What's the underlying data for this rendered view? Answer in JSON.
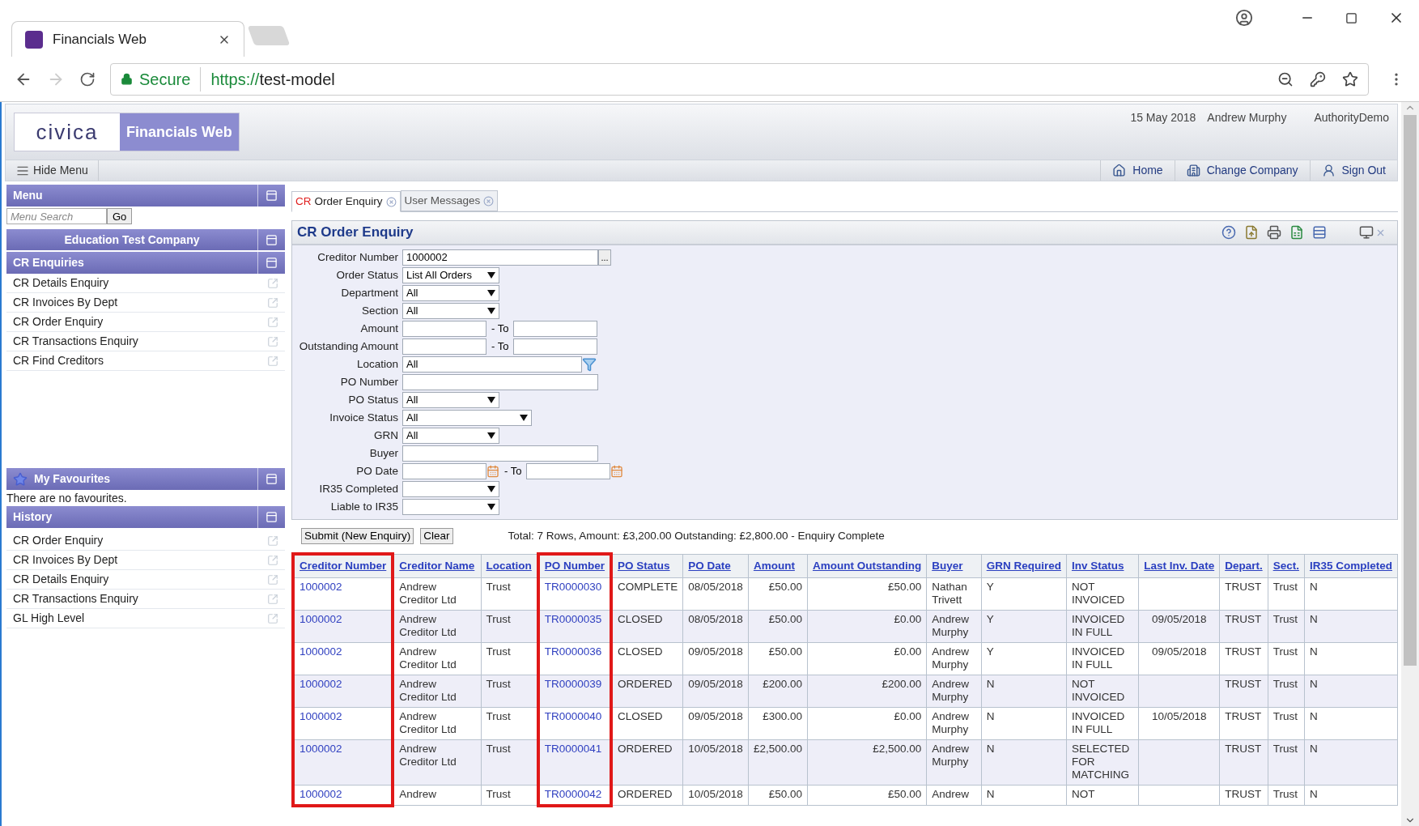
{
  "browser": {
    "tab_title": "Financials Web",
    "secure": "Secure",
    "url_scheme": "https://",
    "url_host": "test-model"
  },
  "header": {
    "logo": "civica",
    "product": "Financials Web",
    "date": "15 May 2018",
    "user": "Andrew Murphy",
    "authority": "AuthorityDemo"
  },
  "toolbar": {
    "hide_menu": "Hide Menu",
    "links": [
      {
        "kind": "home",
        "label": "Home"
      },
      {
        "kind": "company",
        "label": "Change Company"
      },
      {
        "kind": "signout",
        "label": "Sign Out"
      }
    ]
  },
  "sidebar": {
    "menu_title": "Menu",
    "search_placeholder": "Menu Search",
    "go": "Go",
    "company": "Education Test Company",
    "section": "CR Enquiries",
    "items": [
      "CR Details Enquiry",
      "CR Invoices By Dept",
      "CR Order Enquiry",
      "CR Transactions Enquiry",
      "CR Find Creditors"
    ],
    "favourites_title": "My Favourites",
    "favourites_empty": "There are no favourites.",
    "history_title": "History",
    "history": [
      "CR Order Enquiry",
      "CR Invoices By Dept",
      "CR Details Enquiry",
      "CR Transactions Enquiry",
      "GL High Level"
    ]
  },
  "tabs": [
    {
      "code": "CR",
      "label": "Order Enquiry",
      "selected": true
    },
    {
      "label": "User Messages",
      "selected": false
    }
  ],
  "form": {
    "title": "CR Order Enquiry",
    "fields": [
      {
        "kind": "lookup",
        "label": "Creditor Number",
        "value": "1000002",
        "button": "..."
      },
      {
        "kind": "select",
        "label": "Order Status",
        "value": "List All Orders"
      },
      {
        "kind": "select",
        "label": "Department",
        "value": "All"
      },
      {
        "kind": "select",
        "label": "Section",
        "value": "All"
      },
      {
        "kind": "range",
        "label": "Amount",
        "to": "- To"
      },
      {
        "kind": "range",
        "label": "Outstanding Amount",
        "to": "- To"
      },
      {
        "kind": "picker",
        "label": "Location",
        "value": "All"
      },
      {
        "kind": "text",
        "label": "PO Number"
      },
      {
        "kind": "select",
        "label": "PO Status",
        "value": "All"
      },
      {
        "kind": "select",
        "label": "Invoice Status",
        "value": "All",
        "wide": true
      },
      {
        "kind": "select",
        "label": "GRN",
        "value": "All"
      },
      {
        "kind": "text",
        "label": "Buyer"
      },
      {
        "kind": "daterange",
        "label": "PO Date",
        "to": "- To"
      },
      {
        "kind": "select",
        "label": "IR35 Completed"
      },
      {
        "kind": "select",
        "label": "Liable to IR35"
      }
    ]
  },
  "actions": {
    "buttons": [
      "Submit (New Enquiry)",
      "Clear"
    ],
    "summary": "Total: 7 Rows, Amount: £3,200.00 Outstanding: £2,800.00 - Enquiry Complete"
  },
  "table": {
    "columns": [
      {
        "label": "Creditor Number",
        "kind": "link",
        "highlighted": true
      },
      {
        "label": "Creditor Name",
        "kind": "text",
        "highlighted": false
      },
      {
        "label": "Location",
        "kind": "text",
        "highlighted": false
      },
      {
        "label": "PO Number",
        "kind": "link",
        "highlighted": true
      },
      {
        "label": "PO Status",
        "kind": "text",
        "highlighted": false
      },
      {
        "label": "PO Date",
        "kind": "text",
        "highlighted": false
      },
      {
        "label": "Amount",
        "kind": "money",
        "highlighted": false
      },
      {
        "label": "Amount Outstanding",
        "kind": "money",
        "highlighted": false
      },
      {
        "label": "Buyer",
        "kind": "text",
        "highlighted": false
      },
      {
        "label": "GRN Required",
        "kind": "text",
        "highlighted": false
      },
      {
        "label": "Inv Status",
        "kind": "text",
        "highlighted": false
      },
      {
        "label": "Last Inv. Date",
        "kind": "centered",
        "highlighted": false
      },
      {
        "label": "Depart.",
        "kind": "text",
        "highlighted": false
      },
      {
        "label": "Sect.",
        "kind": "text",
        "highlighted": false
      },
      {
        "label": "IR35 Completed",
        "kind": "text",
        "highlighted": false
      }
    ],
    "rows": [
      [
        "1000002",
        "Andrew Creditor Ltd",
        "Trust",
        "TR0000030",
        "COMPLETE",
        "08/05/2018",
        "£50.00",
        "£50.00",
        "Nathan Trivett",
        "Y",
        "NOT INVOICED",
        null,
        "TRUST",
        "Trust",
        "N"
      ],
      [
        "1000002",
        "Andrew Creditor Ltd",
        "Trust",
        "TR0000035",
        "CLOSED",
        "08/05/2018",
        "£50.00",
        "£0.00",
        "Andrew Murphy",
        "Y",
        "INVOICED IN FULL",
        "09/05/2018",
        "TRUST",
        "Trust",
        "N"
      ],
      [
        "1000002",
        "Andrew Creditor Ltd",
        "Trust",
        "TR0000036",
        "CLOSED",
        "09/05/2018",
        "£50.00",
        "£0.00",
        "Andrew Murphy",
        "Y",
        "INVOICED IN FULL",
        "09/05/2018",
        "TRUST",
        "Trust",
        "N"
      ],
      [
        "1000002",
        "Andrew Creditor Ltd",
        "Trust",
        "TR0000039",
        "ORDERED",
        "09/05/2018",
        "£200.00",
        "£200.00",
        "Andrew Murphy",
        "N",
        "NOT INVOICED",
        null,
        "TRUST",
        "Trust",
        "N"
      ],
      [
        "1000002",
        "Andrew Creditor Ltd",
        "Trust",
        "TR0000040",
        "CLOSED",
        "09/05/2018",
        "£300.00",
        "£0.00",
        "Andrew Murphy",
        "N",
        "INVOICED IN FULL",
        "10/05/2018",
        "TRUST",
        "Trust",
        "N"
      ],
      [
        "1000002",
        "Andrew Creditor Ltd",
        "Trust",
        "TR0000041",
        "ORDERED",
        "10/05/2018",
        "£2,500.00",
        "£2,500.00",
        "Andrew Murphy",
        "N",
        "SELECTED FOR MATCHING",
        null,
        "TRUST",
        "Trust",
        "N"
      ],
      [
        "1000002",
        "Andrew",
        "Trust",
        "TR0000042",
        "ORDERED",
        "10/05/2018",
        "£50.00",
        "£50.00",
        "Andrew",
        "N",
        "NOT",
        null,
        "TRUST",
        "Trust",
        "N"
      ]
    ]
  }
}
